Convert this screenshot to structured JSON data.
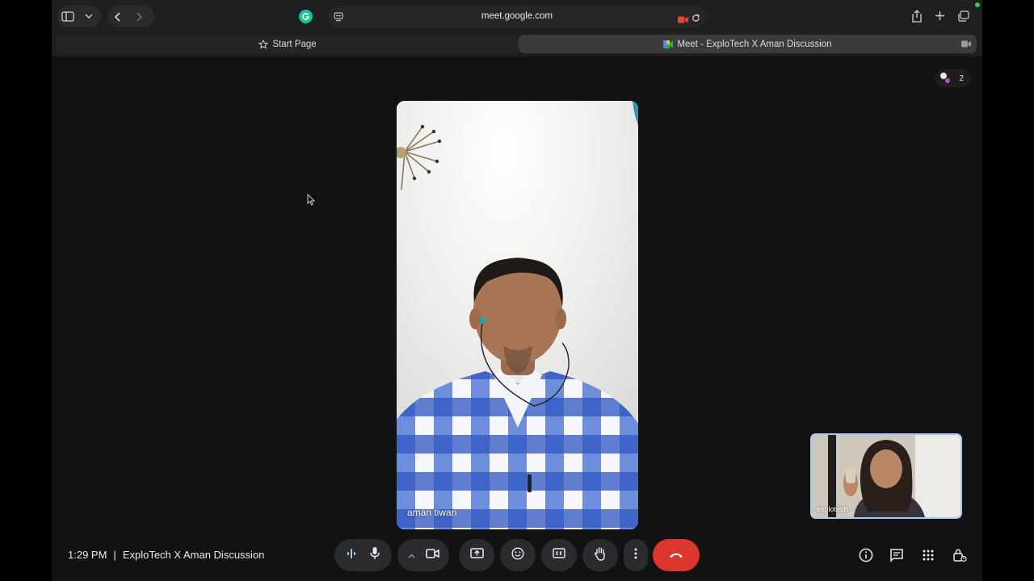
{
  "browser": {
    "url": "meet.google.com",
    "tabs": [
      {
        "label": "Start Page",
        "active": false
      },
      {
        "label": "Meet - ExploTech X Aman Discussion",
        "active": true
      }
    ]
  },
  "meeting": {
    "participant_count": "2",
    "main_participant": "aman tiwari",
    "self_participant": "explotech",
    "time": "1:29 PM",
    "separator": "|",
    "title": "ExploTech X Aman Discussion"
  },
  "colors": {
    "end_call": "#dc362e",
    "self_tile_border": "#a8c7fa",
    "mic_active": "#a8c7fa"
  }
}
